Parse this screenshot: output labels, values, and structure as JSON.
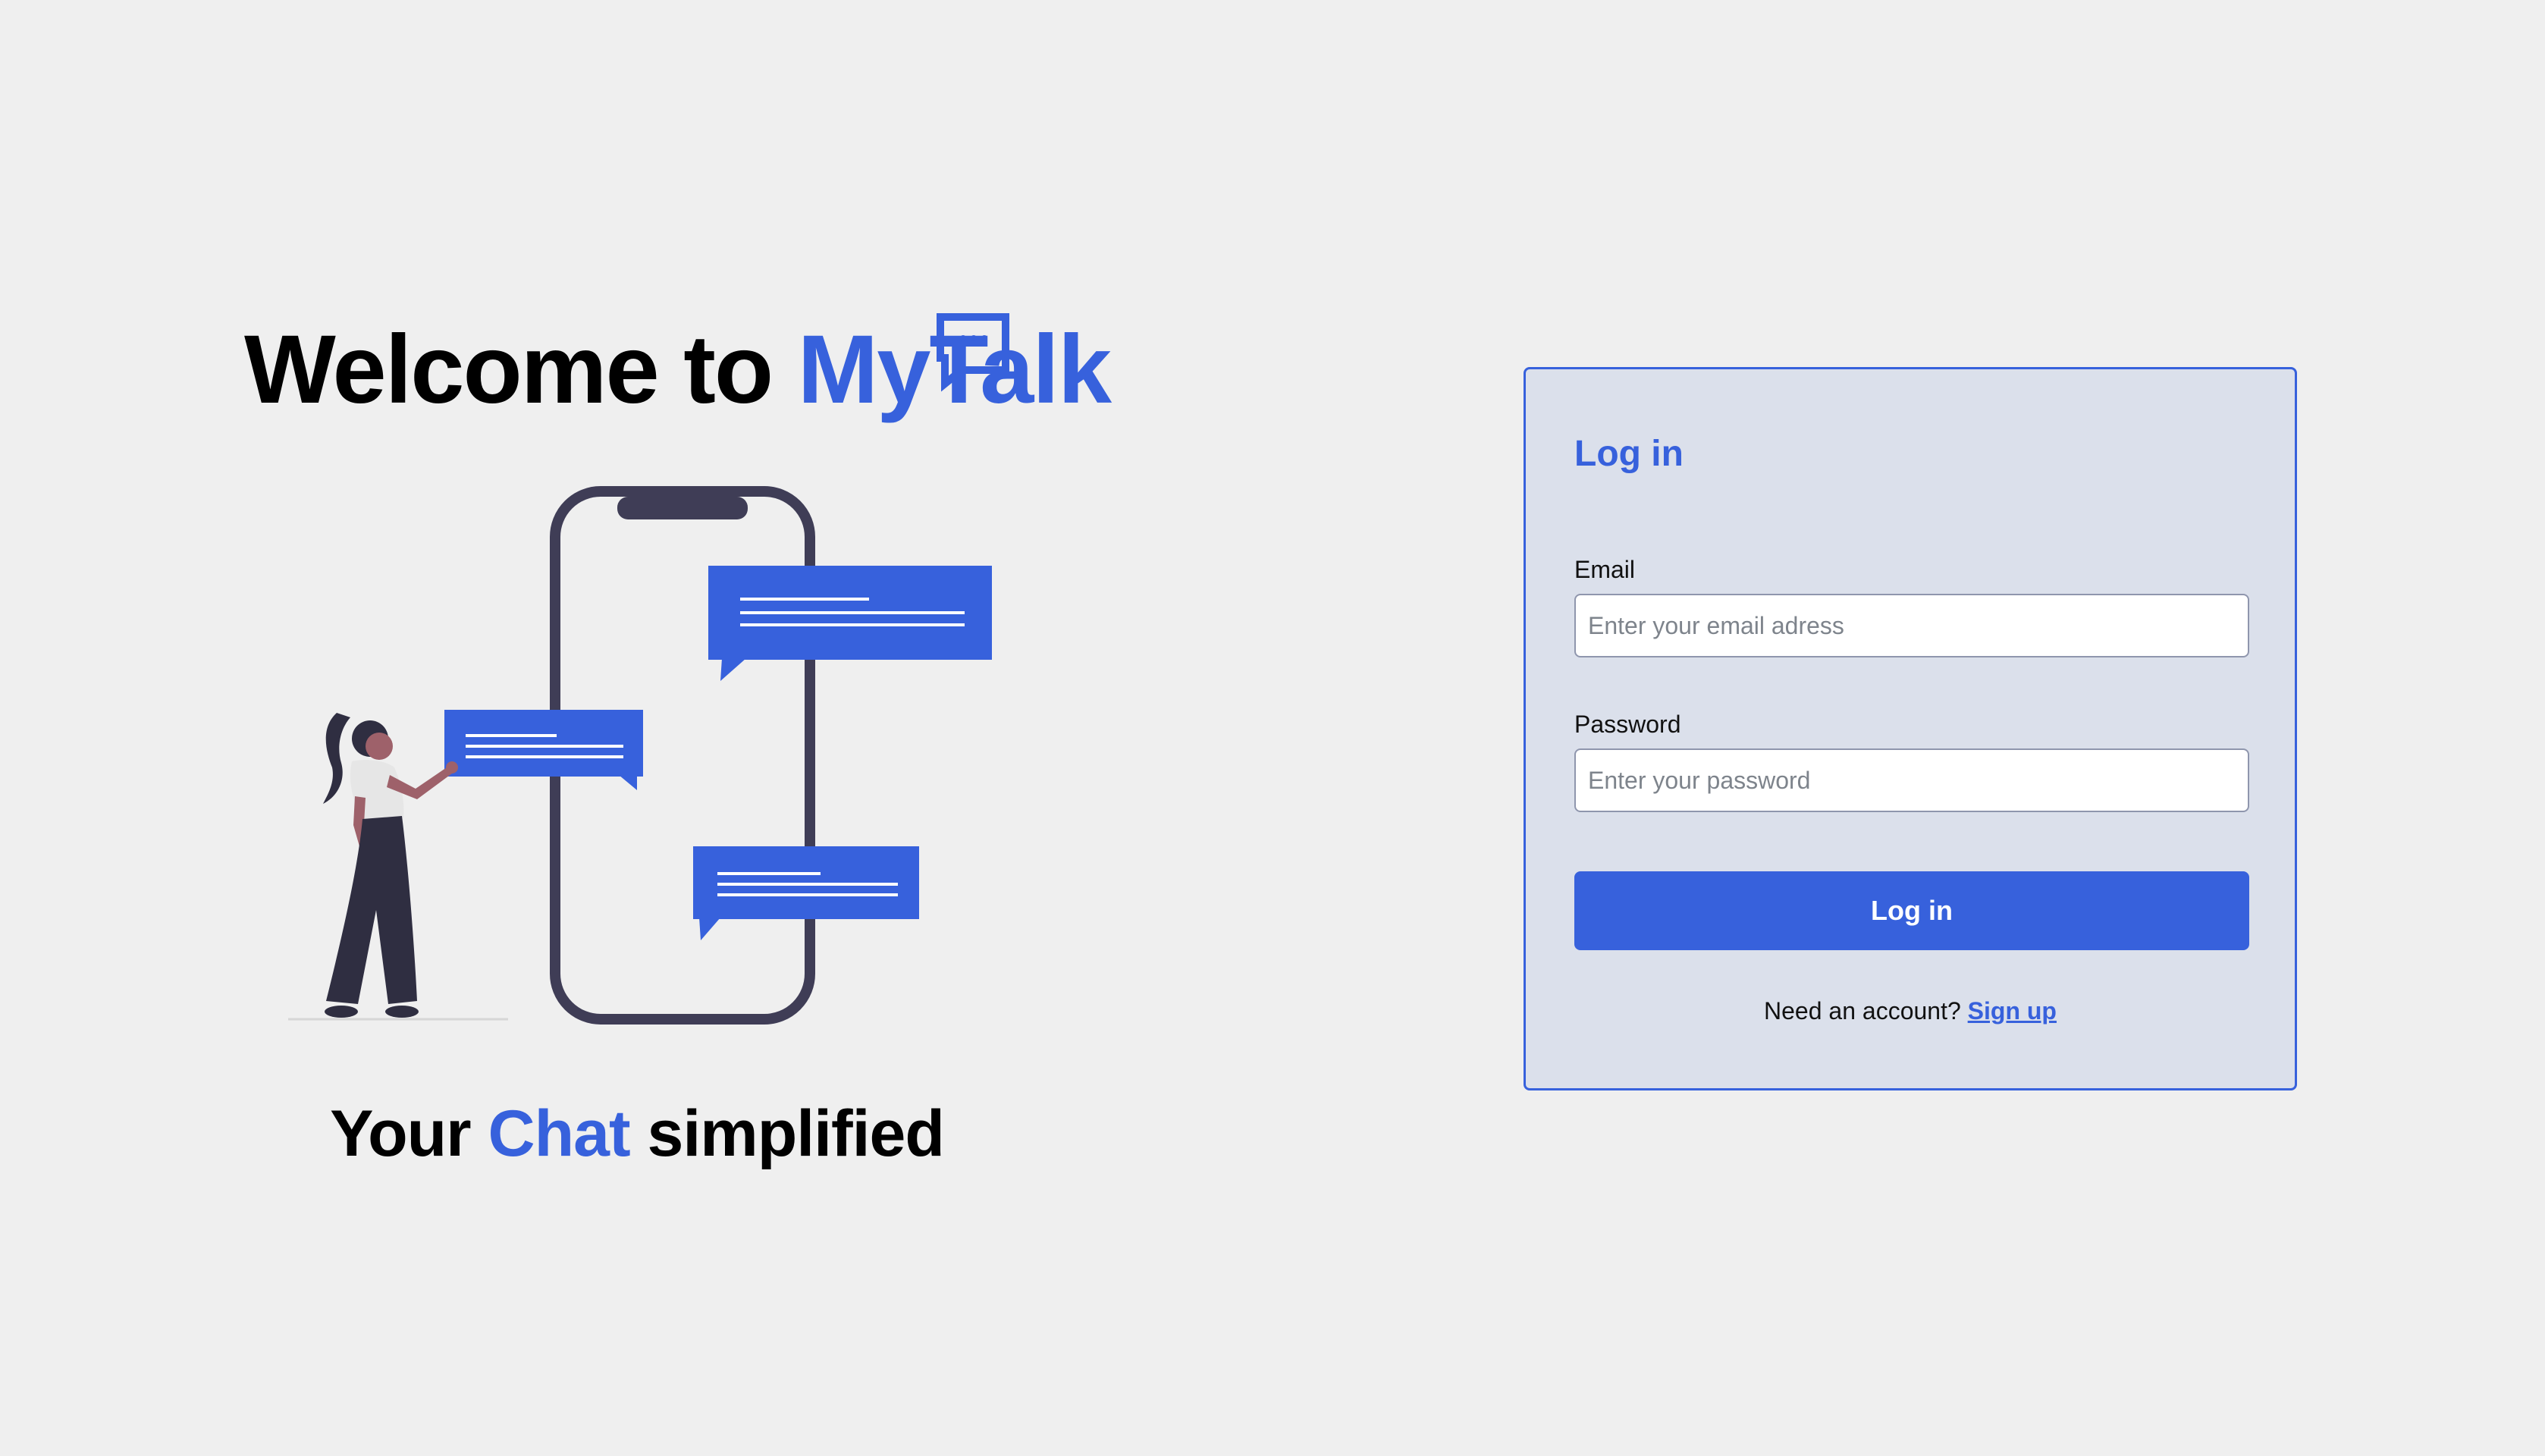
{
  "hero": {
    "welcome_text": "Welcome to ",
    "brand_name": "MyTalk",
    "tagline_prefix": "Your ",
    "tagline_highlight": "Chat",
    "tagline_suffix": " simplified"
  },
  "login": {
    "title": "Log in",
    "email_label": "Email",
    "email_placeholder": "Enter your email adress",
    "email_value": "",
    "password_label": "Password",
    "password_placeholder": "Enter your password",
    "password_value": "",
    "submit_label": "Log in",
    "signup_prompt": "Need an account? ",
    "signup_link": "Sign up"
  },
  "icons": {
    "brand_logo": "chat-bubble-dots-icon",
    "illustration": "woman-with-phone-chat-illustration"
  },
  "colors": {
    "accent": "#3761dc",
    "background": "#efefef",
    "card_background": "#dbe0eb",
    "illustration_dark": "#3f3d56",
    "illustration_figure": "#2f2e41"
  }
}
